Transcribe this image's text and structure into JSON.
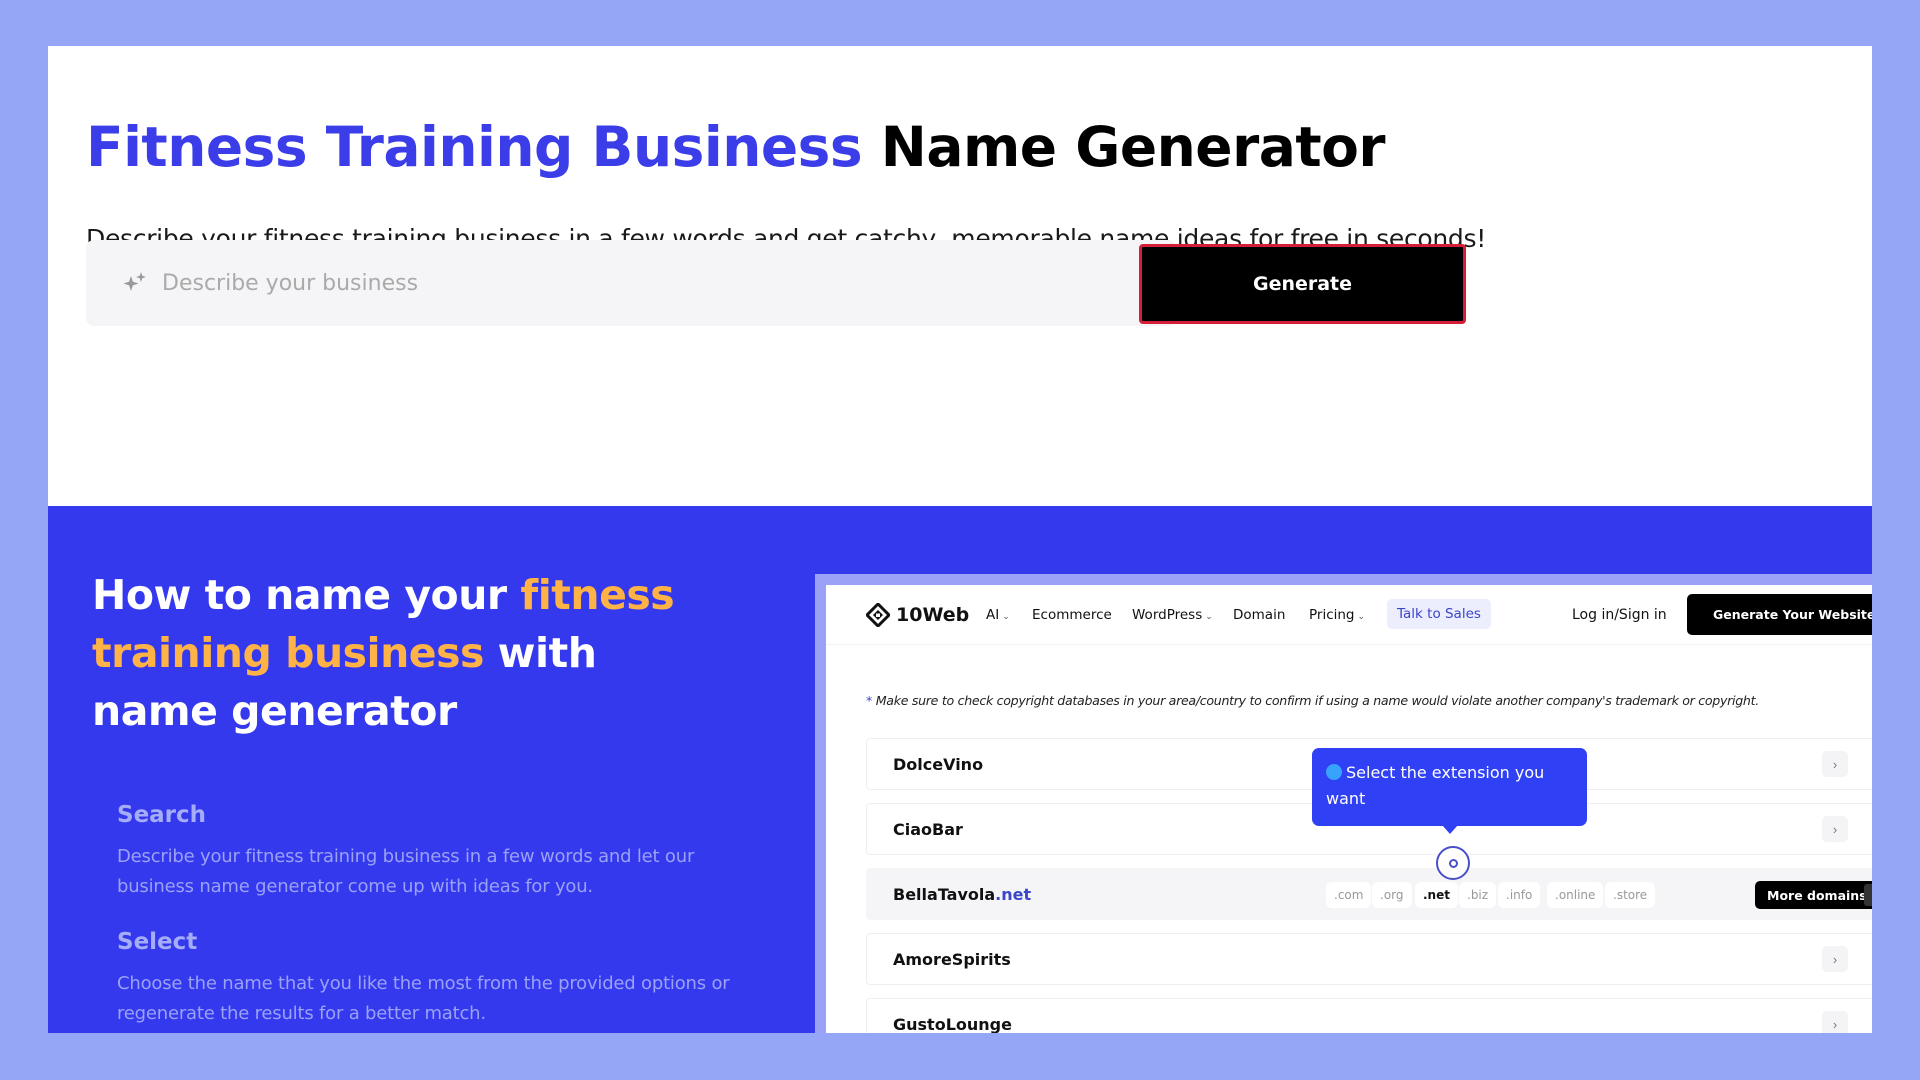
{
  "hero": {
    "title_accent": "Fitness Training Business",
    "title_rest": "Name Generator",
    "subtitle": "Describe your fitness training business in a few words and get catchy, memorable name ideas for free in seconds!",
    "search": {
      "placeholder": "Describe your business",
      "value": "",
      "icon": "sparkle-icon"
    },
    "generate_label": "Generate"
  },
  "how": {
    "title_part1": "How to name your ",
    "title_accent": "fitness training business",
    "title_part2": " with name generator",
    "steps": [
      {
        "title": "Search",
        "description": "Describe your fitness training business in a few words and let our business name generator come up with ideas for you."
      },
      {
        "title": "Select",
        "description": "Choose the name that you like the most from the provided options or regenerate the results for a better match."
      }
    ]
  },
  "preview": {
    "logo_text": "10Web",
    "nav": [
      {
        "label": "AI",
        "dropdown": true
      },
      {
        "label": "Ecommerce",
        "dropdown": false
      },
      {
        "label": "WordPress",
        "dropdown": true
      },
      {
        "label": "Domain",
        "dropdown": false
      },
      {
        "label": "Pricing",
        "dropdown": true
      }
    ],
    "talk_to_sales": "Talk to Sales",
    "login": "Log in/Sign in",
    "cta": "Generate Your Website",
    "note_star": "*",
    "note": "Make sure to check copyright databases in your area/country to confirm if using a name would violate another company's trademark or copyright.",
    "names": [
      {
        "name": "DolceVino",
        "tld": ""
      },
      {
        "name": "CiaoBar",
        "tld": ""
      },
      {
        "name": "BellaTavola",
        "tld": ".net",
        "active": true
      },
      {
        "name": "AmoreSpirits",
        "tld": ""
      },
      {
        "name": "GustoLounge",
        "tld": ""
      }
    ],
    "extensions": [
      ".com",
      ".org",
      ".net",
      ".biz",
      ".info",
      ".online",
      ".store"
    ],
    "selected_extension": ".net",
    "more_domains": "More domains",
    "tooltip": "Select the extension you want",
    "colors": {
      "accent": "#3439ed",
      "highlight": "#ffb347",
      "tooltip": "#3041f5"
    }
  }
}
